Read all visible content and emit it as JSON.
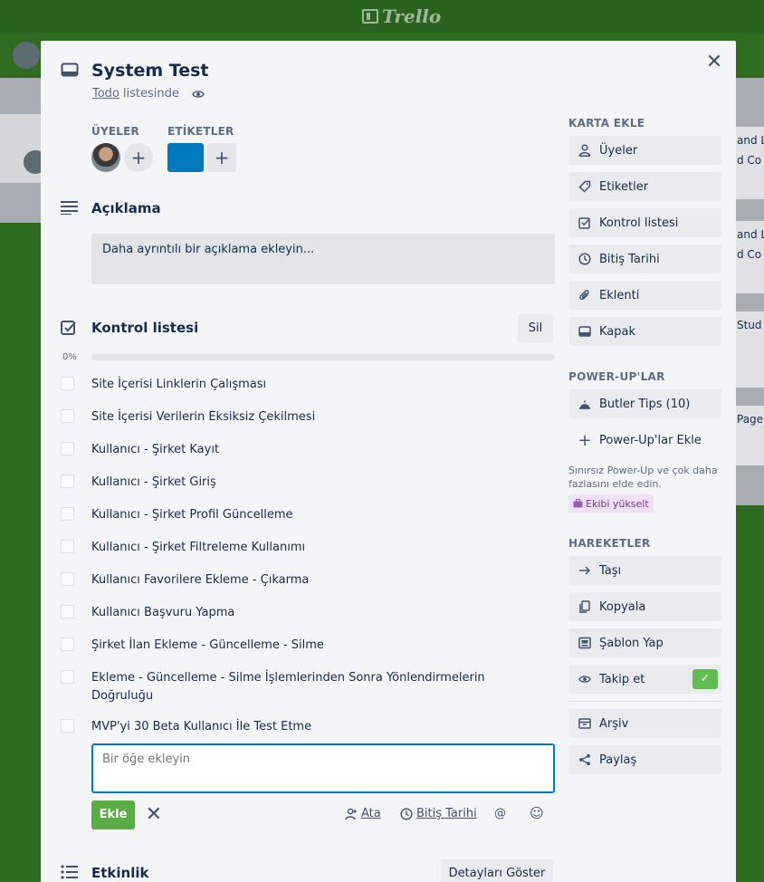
{
  "app": {
    "brand": "Trello"
  },
  "background": {
    "right_cards": [
      "and Lo",
      "d Co",
      "and L",
      "d Co",
      "Stud",
      "Page"
    ]
  },
  "card": {
    "title": "System Test",
    "list_name": "Todo",
    "list_suffix": "listesinde"
  },
  "members": {
    "label": "ÜYELER"
  },
  "labels": {
    "label": "ETİKETLER",
    "chip_color": "#0079bf"
  },
  "description": {
    "title": "Açıklama",
    "placeholder": "Daha ayrıntılı bir açıklama ekleyin..."
  },
  "checklist": {
    "title": "Kontrol listesi",
    "delete_label": "Sil",
    "percent_label": "0%",
    "progress": 0,
    "items": [
      "Site İçerisi Linklerin Çalışması",
      "Site İçerisi Verilerin Eksiksiz Çekilmesi",
      "Kullanıcı - Şirket Kayıt",
      "Kullanıcı - Şirket Giriş",
      "Kullanıcı - Şirket Profil Güncelleme",
      "Kullanıcı - Şirket Filtreleme Kullanımı",
      "Kullanıcı Favorilere Ekleme - Çıkarma",
      "Kullanıcı Başvuru Yapma",
      "Şirket İlan Ekleme - Güncelleme - Silme",
      "Ekleme - Güncelleme - Silme İşlemlerinden Sonra Yönlendirmelerin Doğruluğu",
      "MVP'yi 30 Beta Kullanıcı İle Test Etme"
    ],
    "add_placeholder": "Bir öğe ekleyin",
    "add_button": "Ekle",
    "assign_label": "Ata",
    "due_label": "Bitiş Tarihi",
    "mention_symbol": "@",
    "emoji_symbol": "☺"
  },
  "activity": {
    "title": "Etkinlik",
    "details_button": "Detayları Göster"
  },
  "sidebar": {
    "add_to_card": {
      "heading": "KARTA EKLE",
      "items": [
        {
          "label": "Üyeler",
          "icon": "person-icon"
        },
        {
          "label": "Etiketler",
          "icon": "tag-icon"
        },
        {
          "label": "Kontrol listesi",
          "icon": "checkbox-icon"
        },
        {
          "label": "Bitiş Tarihi",
          "icon": "clock-icon"
        },
        {
          "label": "Eklenti",
          "icon": "paperclip-icon"
        },
        {
          "label": "Kapak",
          "icon": "cover-icon"
        }
      ]
    },
    "powerups": {
      "heading": "POWER-UP'LAR",
      "butler": "Butler Tips (10)",
      "add": "Power-Up'lar Ekle",
      "note": "Sınırsız Power-Up ve çok daha fazlasını elde edin.",
      "upgrade": "Ekibi yükselt"
    },
    "actions": {
      "heading": "HAREKETLER",
      "items": [
        {
          "label": "Taşı",
          "icon": "arrow-right-icon"
        },
        {
          "label": "Kopyala",
          "icon": "copy-icon"
        },
        {
          "label": "Şablon Yap",
          "icon": "template-icon"
        },
        {
          "label": "Takip et",
          "icon": "eye-icon"
        }
      ],
      "archive": "Arşiv",
      "share": "Paylaş",
      "accent": "#61bd4f"
    }
  }
}
